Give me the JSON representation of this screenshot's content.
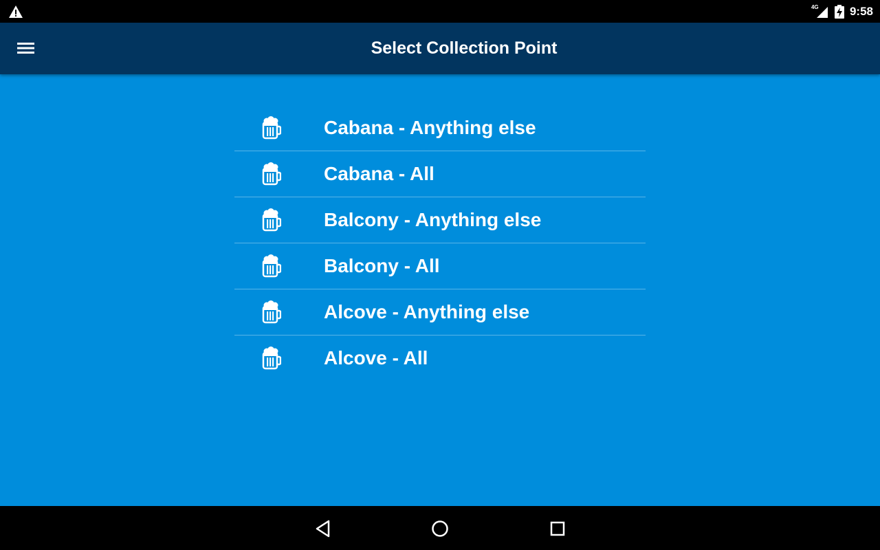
{
  "status_bar": {
    "network": "4G",
    "time": "9:58",
    "icons": [
      "warning-icon",
      "signal-icon",
      "battery-charging-icon"
    ]
  },
  "app_bar": {
    "title": "Select Collection Point",
    "menu_icon": "hamburger-menu-icon"
  },
  "collection_points": [
    {
      "label": "Cabana - Anything else",
      "icon": "beer-mug-icon"
    },
    {
      "label": "Cabana - All",
      "icon": "beer-mug-icon"
    },
    {
      "label": "Balcony - Anything else",
      "icon": "beer-mug-icon"
    },
    {
      "label": "Balcony - All",
      "icon": "beer-mug-icon"
    },
    {
      "label": "Alcove - Anything else",
      "icon": "beer-mug-icon"
    },
    {
      "label": "Alcove - All",
      "icon": "beer-mug-icon"
    }
  ],
  "nav_bar": {
    "icons": [
      "back-icon",
      "home-icon",
      "recents-icon"
    ]
  },
  "colors": {
    "background": "#008ddc",
    "app_bar": "#02355f",
    "system_bars": "#000000",
    "text": "#ffffff"
  }
}
